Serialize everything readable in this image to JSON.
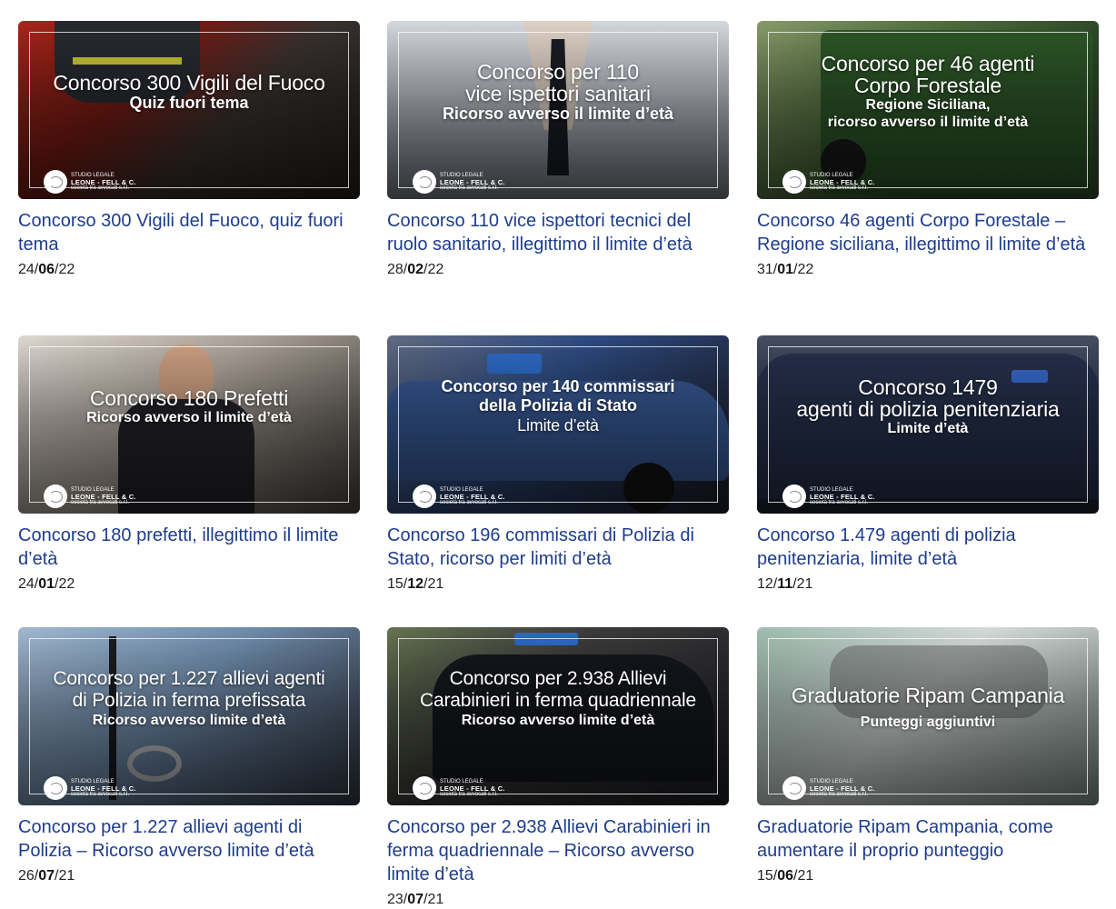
{
  "cards": [
    {
      "thumb_light": "Concorso 300 Vigili del Fuoco",
      "thumb_bold": "Quiz fuori tema",
      "title": "Concorso 300 Vigili del Fuoco, quiz fuori tema",
      "date_day": "24/",
      "date_month": "06",
      "date_year": "/22"
    },
    {
      "thumb_light": "Concorso per 110\nvice ispettori sanitari",
      "thumb_bold": "Ricorso avverso il limite d’età",
      "title": "Concorso 110 vice ispettori tecnici del ruolo sanitario, illegittimo il limite d’età",
      "date_day": "28/",
      "date_month": "02",
      "date_year": "/22"
    },
    {
      "thumb_light": "Concorso per 46 agenti\nCorpo Forestale",
      "thumb_bold": "Regione Siciliana,\nricorso avverso il limite d’età",
      "title": "Concorso 46 agenti Corpo Forestale – Regione siciliana, illegittimo il limite d’età",
      "date_day": "31/",
      "date_month": "01",
      "date_year": "/22"
    },
    {
      "thumb_light": "Concorso 180 Prefetti",
      "thumb_bold": "Ricorso avverso il limite d’età",
      "title": "Concorso 180 prefetti, illegittimo il limite d’età",
      "date_day": "24/",
      "date_month": "01",
      "date_year": "/22"
    },
    {
      "thumb_bold": "Concorso per 140 commissari\ndella Polizia di Stato",
      "thumb_light": "Limite d’età",
      "title": "Concorso 196 commissari di Polizia di Stato, ricorso per limiti d’età",
      "date_day": "15/",
      "date_month": "12",
      "date_year": "/21"
    },
    {
      "thumb_light": "Concorso 1479\nagenti di polizia penitenziaria",
      "thumb_bold": "Limite d’età",
      "title": "Concorso 1.479 agenti di polizia penitenziaria, limite d’età",
      "date_day": "12/",
      "date_month": "11",
      "date_year": "/21"
    },
    {
      "thumb_light": "Concorso per 1.227 allievi agenti\ndi Polizia in ferma prefissata",
      "thumb_bold": "Ricorso avverso limite d’età",
      "title": "Concorso per 1.227 allievi agenti di Polizia – Ricorso avverso limite d’età",
      "date_day": "26/",
      "date_month": "07",
      "date_year": "/21"
    },
    {
      "thumb_light": "Concorso per 2.938 Allievi\nCarabinieri in ferma quadriennale",
      "thumb_bold": "Ricorso avverso limite d’età",
      "title": "Concorso per 2.938 Allievi Carabinieri in ferma quadriennale – Ricorso avverso limite d’età",
      "date_day": "23/",
      "date_month": "07",
      "date_year": "/21"
    },
    {
      "thumb_light": "Graduatorie Ripam Campania",
      "thumb_bold": "Punteggi aggiuntivi",
      "title": "Graduatorie Ripam Campania, come aumentare il proprio punteggio",
      "date_day": "15/",
      "date_month": "06",
      "date_year": "/21"
    }
  ],
  "logo": {
    "line1": "STUDIO LEGALE",
    "line2": "LEONE - FELL & C.",
    "line3": "società tra avvocati s.r.l."
  }
}
